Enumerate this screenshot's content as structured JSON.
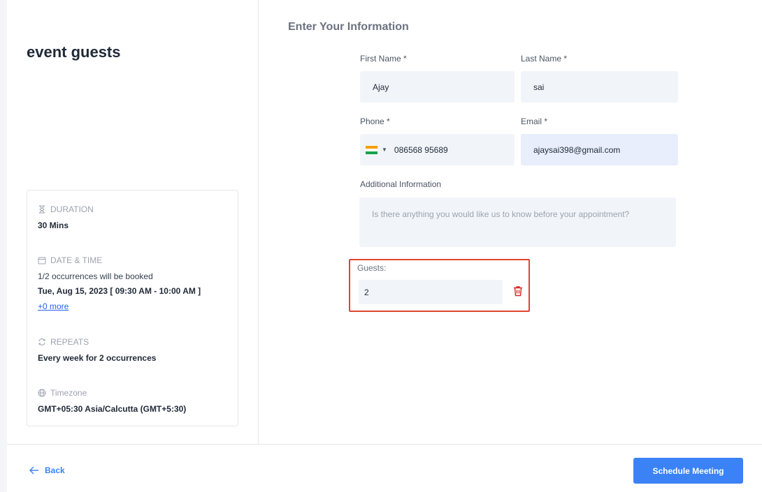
{
  "event": {
    "title": "event guests"
  },
  "summary": {
    "duration_label": "DURATION",
    "duration_value": "30 Mins",
    "datetime_label": "DATE & TIME",
    "occurrences_text": "1/2 occurrences will be booked",
    "datetime_value": "Tue, Aug 15, 2023 [ 09:30 AM - 10:00 AM ]",
    "more_link": "+0 more",
    "repeats_label": "REPEATS",
    "repeats_value": "Every week for 2 occurrences",
    "timezone_label": "Timezone",
    "timezone_value": "GMT+05:30 Asia/Calcutta (GMT+5:30)"
  },
  "form": {
    "title": "Enter Your Information",
    "first_name_label": "First Name *",
    "first_name_value": "Ajay",
    "last_name_label": "Last Name *",
    "last_name_value": "sai",
    "phone_label": "Phone *",
    "phone_value": "086568 95689",
    "email_label": "Email *",
    "email_value": "ajaysai398@gmail.com",
    "additional_label": "Additional Information",
    "additional_placeholder": "Is there anything you would like us to know before your appointment?",
    "guests_label": "Guests:",
    "guests_value": "2"
  },
  "footer": {
    "back_label": "Back",
    "schedule_label": "Schedule Meeting"
  },
  "colors": {
    "primary": "#3b82f6",
    "highlight_border": "#e0452c",
    "trash": "#dc2626"
  },
  "icons": {
    "duration": "hourglass-icon",
    "datetime": "calendar-icon",
    "repeats": "repeat-icon",
    "timezone": "globe-icon",
    "phone_country": "india-flag-icon",
    "guest_remove": "trash-icon",
    "back": "arrow-left-icon"
  }
}
